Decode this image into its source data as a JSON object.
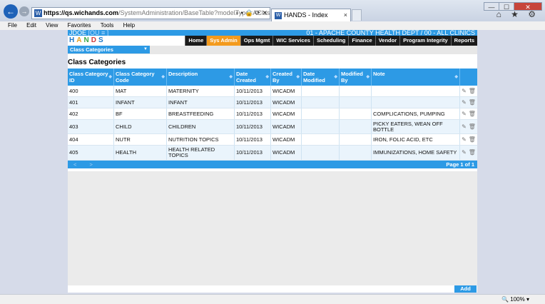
{
  "browser": {
    "url_host": "https://qs.wichands.com",
    "url_path": "/SystemAdministration/BaseTable?modelType=AClassCategories",
    "url_tools": "⌕ ▾ 🔒 ⟳ ✕",
    "tab_title": "HANDS - Index",
    "tab_close": "×",
    "window_buttons": [
      "—",
      "☐",
      "✕"
    ],
    "right_icons": "⌂ ★ ⚙",
    "menu": [
      "File",
      "Edit",
      "View",
      "Favorites",
      "Tools",
      "Help"
    ],
    "zoom": "100%"
  },
  "header": {
    "user": "JDOE",
    "user_suffix": "[OU ≡ ]",
    "org": "01 - APACHE COUNTY HEALTH DEPT / 00 - ALL CLINICS",
    "logo_letters": [
      "H",
      "A",
      "N",
      "D",
      "S"
    ]
  },
  "topnav": [
    "Home",
    "Sys Admin",
    "Ops Mgmt",
    "WIC Services",
    "Scheduling",
    "Finance",
    "Vendor",
    "Program Integrity",
    "Reports"
  ],
  "topnav_active": "Sys Admin",
  "category_dropdown": "Class Categories",
  "page_title": "Class Categories",
  "grid": {
    "columns": [
      "Class Category ID",
      "Class Category Code",
      "Description",
      "Date Created",
      "Created By",
      "Date Modified",
      "Modified By",
      "Note"
    ],
    "rows": [
      [
        "400",
        "MAT",
        "MATERNITY",
        "10/11/2013",
        "WICADM",
        "",
        "",
        ""
      ],
      [
        "401",
        "INFANT",
        "INFANT",
        "10/11/2013",
        "WICADM",
        "",
        "",
        ""
      ],
      [
        "402",
        "BF",
        "BREASTFEEDING",
        "10/11/2013",
        "WICADM",
        "",
        "",
        "COMPLICATIONS, PUMPING"
      ],
      [
        "403",
        "CHILD",
        "CHILDREN",
        "10/11/2013",
        "WICADM",
        "",
        "",
        "PICKY EATERS, WEAN OFF BOTTLE"
      ],
      [
        "404",
        "NUTR",
        "NUTRITION TOPICS",
        "10/11/2013",
        "WICADM",
        "",
        "",
        "IRON, FOLIC ACID, ETC"
      ],
      [
        "405",
        "HEALTH",
        "HEALTH RELATED TOPICS",
        "10/11/2013",
        "WICADM",
        "",
        "",
        "IMMUNIZATIONS, HOME SAFETY"
      ]
    ],
    "pager_arrows": "< >",
    "page_label": "Page 1 of 1"
  },
  "add_button": "Add"
}
